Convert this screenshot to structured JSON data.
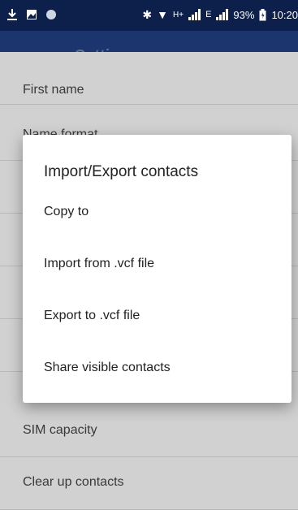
{
  "status": {
    "bluetooth": "✱",
    "wifi": "▼",
    "net1": "H+",
    "net2": "E",
    "battery": "93%",
    "time": "10:20"
  },
  "toolbar": {
    "title": "Settings"
  },
  "list": {
    "items": [
      "First name",
      "Name format",
      "",
      "",
      "",
      "",
      "SIM capacity",
      "Clear up contacts"
    ]
  },
  "dialog": {
    "title": "Import/Export contacts",
    "options": [
      "Copy to",
      "Import from .vcf file",
      "Export to .vcf file",
      "Share visible contacts"
    ]
  }
}
